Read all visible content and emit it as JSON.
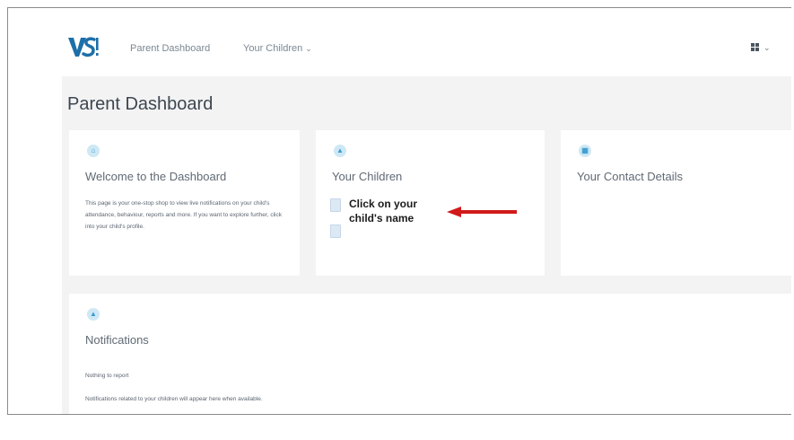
{
  "header": {
    "logo_text": "VS!",
    "nav": {
      "dashboard_label": "Parent Dashboard",
      "children_label": "Your Children"
    },
    "apps_icon": "grid-icon"
  },
  "page": {
    "title": "Parent Dashboard"
  },
  "cards": {
    "welcome": {
      "icon": "home-icon",
      "title": "Welcome to the Dashboard",
      "body": "This page is your one-stop shop to view live notifications on your child's attendance, behaviour, reports and more. If you want to explore further, click into your child's profile."
    },
    "children": {
      "icon": "person-icon",
      "title": "Your Children",
      "child_icons": [
        "document-icon",
        "document-icon"
      ],
      "callout_line1": "Click on your",
      "callout_line2": "child's name"
    },
    "contact": {
      "icon": "id-card-icon",
      "title": "Your Contact Details"
    },
    "notifications": {
      "icon": "bell-icon",
      "title": "Notifications",
      "status": "Nothing to report",
      "body": "Notifications related to your children will appear here when available."
    }
  },
  "colors": {
    "arrow": "#d11a1a",
    "accent": "#3a9bd0",
    "background": "#f3f3f3"
  }
}
